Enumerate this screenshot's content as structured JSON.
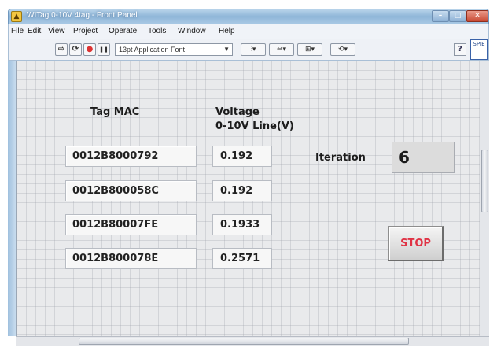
{
  "window": {
    "title": "WITag 0-10V 4tag - Front Panel",
    "app_icon": "labview-vi-icon"
  },
  "menu": {
    "items": [
      "File",
      "Edit",
      "View",
      "Project",
      "Operate",
      "Tools",
      "Window",
      "Help"
    ]
  },
  "toolbar": {
    "font_selector": "13pt Application Font",
    "run_glyph": "⇨",
    "run_continuous_glyph": "⟳",
    "abort_glyph": "●",
    "pause_glyph": "❚❚",
    "align_glyph": "⫶▾",
    "distribute_glyph": "⇔▾",
    "resize_glyph": "⊞▾",
    "reorder_glyph": "⟲▾",
    "help_glyph": "?",
    "thumb_text": "SPIE"
  },
  "panel": {
    "col_mac_header": "Tag MAC",
    "col_voltage_header_line1": "Voltage",
    "col_voltage_header_line2": "0-10V Line(V)",
    "rows": [
      {
        "mac": "0012B8000792",
        "voltage": "0.192"
      },
      {
        "mac": "0012B800058C",
        "voltage": "0.192"
      },
      {
        "mac": "0012B80007FE",
        "voltage": "0.1933"
      },
      {
        "mac": "0012B800078E",
        "voltage": "0.2571"
      }
    ],
    "iteration_label": "Iteration",
    "iteration_value": "6",
    "stop_label": "STOP"
  },
  "colors": {
    "stop_text": "#e03244",
    "panel_bg": "#e9eaec",
    "titlebar": "#8fb6d8"
  }
}
